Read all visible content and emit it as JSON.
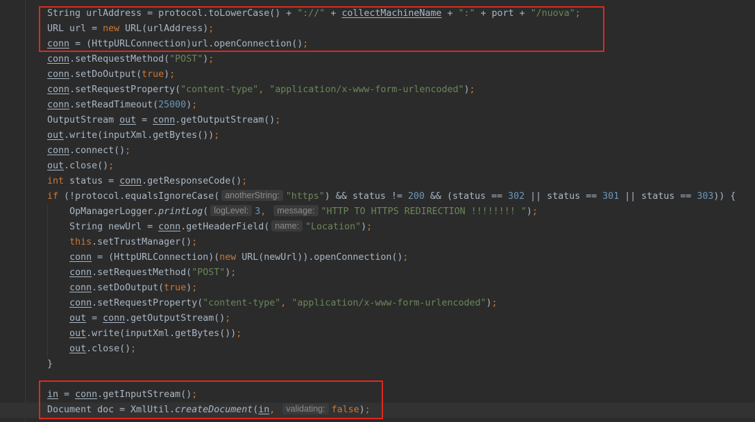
{
  "theme": {
    "background": "#2B2B2B",
    "current_line": "#323232",
    "plain": "#A9B7C6",
    "keyword": "#CC7832",
    "string": "#6A8759",
    "number": "#6897BB",
    "hint_text": "#8C8C8C",
    "hint_bg": "#3B3B3B",
    "indent_guide": "#3A3A3A",
    "highlight_box": "#E0281E"
  },
  "code": {
    "lines": [
      {
        "indent": 2,
        "tokens": [
          {
            "k": "p",
            "t": "String urlAddress = protocol.toLowerCase() + "
          },
          {
            "k": "str",
            "t": "\"://\""
          },
          {
            "k": "p",
            "t": " + "
          },
          {
            "k": "var",
            "t": "collectMachineName"
          },
          {
            "k": "p",
            "t": " + "
          },
          {
            "k": "str",
            "t": "\":\""
          },
          {
            "k": "p",
            "t": " + port + "
          },
          {
            "k": "str",
            "t": "\"/nuova\""
          },
          {
            "k": "op",
            "t": ";"
          }
        ]
      },
      {
        "indent": 2,
        "tokens": [
          {
            "k": "p",
            "t": "URL url = "
          },
          {
            "k": "kw",
            "t": "new"
          },
          {
            "k": "p",
            "t": " URL(urlAddress)"
          },
          {
            "k": "op",
            "t": ";"
          }
        ]
      },
      {
        "indent": 2,
        "tokens": [
          {
            "k": "var",
            "t": "conn"
          },
          {
            "k": "p",
            "t": " = (HttpURLConnection)url.openConnection()"
          },
          {
            "k": "op",
            "t": ";"
          }
        ]
      },
      {
        "indent": 2,
        "tokens": [
          {
            "k": "var",
            "t": "conn"
          },
          {
            "k": "p",
            "t": ".setRequestMethod("
          },
          {
            "k": "str",
            "t": "\"POST\""
          },
          {
            "k": "p",
            "t": ")"
          },
          {
            "k": "op",
            "t": ";"
          }
        ]
      },
      {
        "indent": 2,
        "tokens": [
          {
            "k": "var",
            "t": "conn"
          },
          {
            "k": "p",
            "t": ".setDoOutput("
          },
          {
            "k": "kw",
            "t": "true"
          },
          {
            "k": "p",
            "t": ")"
          },
          {
            "k": "op",
            "t": ";"
          }
        ]
      },
      {
        "indent": 2,
        "tokens": [
          {
            "k": "var",
            "t": "conn"
          },
          {
            "k": "p",
            "t": ".setRequestProperty("
          },
          {
            "k": "str",
            "t": "\"content-type\""
          },
          {
            "k": "op",
            "t": ","
          },
          {
            "k": "p",
            "t": " "
          },
          {
            "k": "str",
            "t": "\"application/x-www-form-urlencoded\""
          },
          {
            "k": "p",
            "t": ")"
          },
          {
            "k": "op",
            "t": ";"
          }
        ]
      },
      {
        "indent": 2,
        "tokens": [
          {
            "k": "var",
            "t": "conn"
          },
          {
            "k": "p",
            "t": ".setReadTimeout("
          },
          {
            "k": "num",
            "t": "25000"
          },
          {
            "k": "p",
            "t": ")"
          },
          {
            "k": "op",
            "t": ";"
          }
        ]
      },
      {
        "indent": 2,
        "tokens": [
          {
            "k": "p",
            "t": "OutputStream "
          },
          {
            "k": "var",
            "t": "out"
          },
          {
            "k": "p",
            "t": " = "
          },
          {
            "k": "var",
            "t": "conn"
          },
          {
            "k": "p",
            "t": ".getOutputStream()"
          },
          {
            "k": "op",
            "t": ";"
          }
        ]
      },
      {
        "indent": 2,
        "tokens": [
          {
            "k": "var",
            "t": "out"
          },
          {
            "k": "p",
            "t": ".write(inputXml.getBytes())"
          },
          {
            "k": "op",
            "t": ";"
          }
        ]
      },
      {
        "indent": 2,
        "tokens": [
          {
            "k": "var",
            "t": "conn"
          },
          {
            "k": "p",
            "t": ".connect()"
          },
          {
            "k": "op",
            "t": ";"
          }
        ]
      },
      {
        "indent": 2,
        "tokens": [
          {
            "k": "var",
            "t": "out"
          },
          {
            "k": "p",
            "t": ".close()"
          },
          {
            "k": "op",
            "t": ";"
          }
        ]
      },
      {
        "indent": 2,
        "tokens": [
          {
            "k": "kw",
            "t": "int"
          },
          {
            "k": "p",
            "t": " status = "
          },
          {
            "k": "var",
            "t": "conn"
          },
          {
            "k": "p",
            "t": ".getResponseCode()"
          },
          {
            "k": "op",
            "t": ";"
          }
        ]
      },
      {
        "indent": 2,
        "tokens": [
          {
            "k": "kw",
            "t": "if"
          },
          {
            "k": "p",
            "t": " (!protocol.equalsIgnoreCase("
          },
          {
            "k": "hint",
            "t": "anotherString:"
          },
          {
            "k": "str",
            "t": "\"https\""
          },
          {
            "k": "p",
            "t": ") && status != "
          },
          {
            "k": "num",
            "t": "200"
          },
          {
            "k": "p",
            "t": " && (status == "
          },
          {
            "k": "num",
            "t": "302"
          },
          {
            "k": "p",
            "t": " || status == "
          },
          {
            "k": "num",
            "t": "301"
          },
          {
            "k": "p",
            "t": " || status == "
          },
          {
            "k": "num",
            "t": "303"
          },
          {
            "k": "p",
            "t": ")) {"
          }
        ]
      },
      {
        "indent": 3,
        "tokens": [
          {
            "k": "p",
            "t": "OpManagerLogger."
          },
          {
            "k": "static",
            "t": "printLog"
          },
          {
            "k": "p",
            "t": "("
          },
          {
            "k": "hint",
            "t": "logLevel:"
          },
          {
            "k": "num",
            "t": "3"
          },
          {
            "k": "op",
            "t": ","
          },
          {
            "k": "p",
            "t": " "
          },
          {
            "k": "hint",
            "t": "message:"
          },
          {
            "k": "str",
            "t": "\"HTTP TO HTTPS REDIRECTION !!!!!!!! \""
          },
          {
            "k": "p",
            "t": ")"
          },
          {
            "k": "op",
            "t": ";"
          }
        ]
      },
      {
        "indent": 3,
        "tokens": [
          {
            "k": "p",
            "t": "String newUrl = "
          },
          {
            "k": "var",
            "t": "conn"
          },
          {
            "k": "p",
            "t": ".getHeaderField("
          },
          {
            "k": "hint",
            "t": "name:"
          },
          {
            "k": "str",
            "t": "\"Location\""
          },
          {
            "k": "p",
            "t": ")"
          },
          {
            "k": "op",
            "t": ";"
          }
        ]
      },
      {
        "indent": 3,
        "tokens": [
          {
            "k": "kw",
            "t": "this"
          },
          {
            "k": "p",
            "t": ".setTrustManager()"
          },
          {
            "k": "op",
            "t": ";"
          }
        ]
      },
      {
        "indent": 3,
        "tokens": [
          {
            "k": "var",
            "t": "conn"
          },
          {
            "k": "p",
            "t": " = (HttpURLConnection)("
          },
          {
            "k": "kw",
            "t": "new"
          },
          {
            "k": "p",
            "t": " URL(newUrl)).openConnection()"
          },
          {
            "k": "op",
            "t": ";"
          }
        ]
      },
      {
        "indent": 3,
        "tokens": [
          {
            "k": "var",
            "t": "conn"
          },
          {
            "k": "p",
            "t": ".setRequestMethod("
          },
          {
            "k": "str",
            "t": "\"POST\""
          },
          {
            "k": "p",
            "t": ")"
          },
          {
            "k": "op",
            "t": ";"
          }
        ]
      },
      {
        "indent": 3,
        "tokens": [
          {
            "k": "var",
            "t": "conn"
          },
          {
            "k": "p",
            "t": ".setDoOutput("
          },
          {
            "k": "kw",
            "t": "true"
          },
          {
            "k": "p",
            "t": ")"
          },
          {
            "k": "op",
            "t": ";"
          }
        ]
      },
      {
        "indent": 3,
        "tokens": [
          {
            "k": "var",
            "t": "conn"
          },
          {
            "k": "p",
            "t": ".setRequestProperty("
          },
          {
            "k": "str",
            "t": "\"content-type\""
          },
          {
            "k": "op",
            "t": ","
          },
          {
            "k": "p",
            "t": " "
          },
          {
            "k": "str",
            "t": "\"application/x-www-form-urlencoded\""
          },
          {
            "k": "p",
            "t": ")"
          },
          {
            "k": "op",
            "t": ";"
          }
        ]
      },
      {
        "indent": 3,
        "tokens": [
          {
            "k": "var",
            "t": "out"
          },
          {
            "k": "p",
            "t": " = "
          },
          {
            "k": "var",
            "t": "conn"
          },
          {
            "k": "p",
            "t": ".getOutputStream()"
          },
          {
            "k": "op",
            "t": ";"
          }
        ]
      },
      {
        "indent": 3,
        "tokens": [
          {
            "k": "var",
            "t": "out"
          },
          {
            "k": "p",
            "t": ".write(inputXml.getBytes())"
          },
          {
            "k": "op",
            "t": ";"
          }
        ]
      },
      {
        "indent": 3,
        "tokens": [
          {
            "k": "var",
            "t": "out"
          },
          {
            "k": "p",
            "t": ".close()"
          },
          {
            "k": "op",
            "t": ";"
          }
        ]
      },
      {
        "indent": 2,
        "tokens": [
          {
            "k": "p",
            "t": "}"
          }
        ]
      },
      {
        "indent": 2,
        "tokens": []
      },
      {
        "indent": 2,
        "tokens": [
          {
            "k": "var",
            "t": "in"
          },
          {
            "k": "p",
            "t": " = "
          },
          {
            "k": "var",
            "t": "conn"
          },
          {
            "k": "p",
            "t": ".getInputStream()"
          },
          {
            "k": "op",
            "t": ";"
          }
        ]
      },
      {
        "indent": 2,
        "current": true,
        "tokens": [
          {
            "k": "p",
            "t": "Document doc = XmlUtil."
          },
          {
            "k": "static",
            "t": "createDocument"
          },
          {
            "k": "p",
            "t": "("
          },
          {
            "k": "var",
            "t": "in"
          },
          {
            "k": "op",
            "t": ","
          },
          {
            "k": "p",
            "t": " "
          },
          {
            "k": "hint",
            "t": "validating:"
          },
          {
            "k": "kw",
            "t": "false"
          },
          {
            "k": "p",
            "t": ")"
          },
          {
            "k": "op",
            "t": ";"
          }
        ]
      }
    ]
  }
}
